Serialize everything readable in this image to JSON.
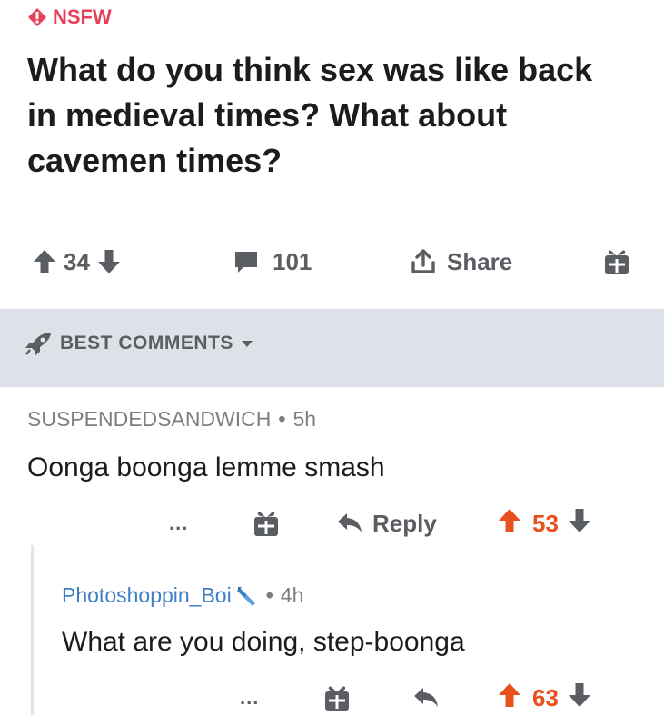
{
  "post": {
    "nsfw_label": "NSFW",
    "title": "What do you think sex was like back in medieval times? What about cavemen times?",
    "score": "34",
    "comments_count": "101",
    "share_label": "Share"
  },
  "sort": {
    "label": "BEST COMMENTS"
  },
  "comments": [
    {
      "author": "SUSPENDEDSANDWICH",
      "time": "5h",
      "text": "Oonga boonga lemme smash",
      "more": "...",
      "reply_label": "Reply",
      "score": "53"
    },
    {
      "author": "Photoshoppin_Boi",
      "time": "4h",
      "text": "What are you doing, step-boonga",
      "more": "...",
      "score": "63"
    }
  ],
  "colors": {
    "nsfw": "#e4425b",
    "upvote_active": "#e8511d",
    "text_muted": "#5a5e63",
    "username_blue": "#3f7fc5",
    "divider_bg": "#dde2e8"
  },
  "icons": {
    "nsfw": "diamond-icon",
    "upvote": "arrow-up-icon",
    "downvote": "arrow-down-icon",
    "comments": "comment-bubble-icon",
    "share": "share-upload-icon",
    "award": "gift-icon",
    "sort": "rocket-icon",
    "reply": "reply-arrow-icon",
    "flair": "pencil-flair-icon"
  }
}
